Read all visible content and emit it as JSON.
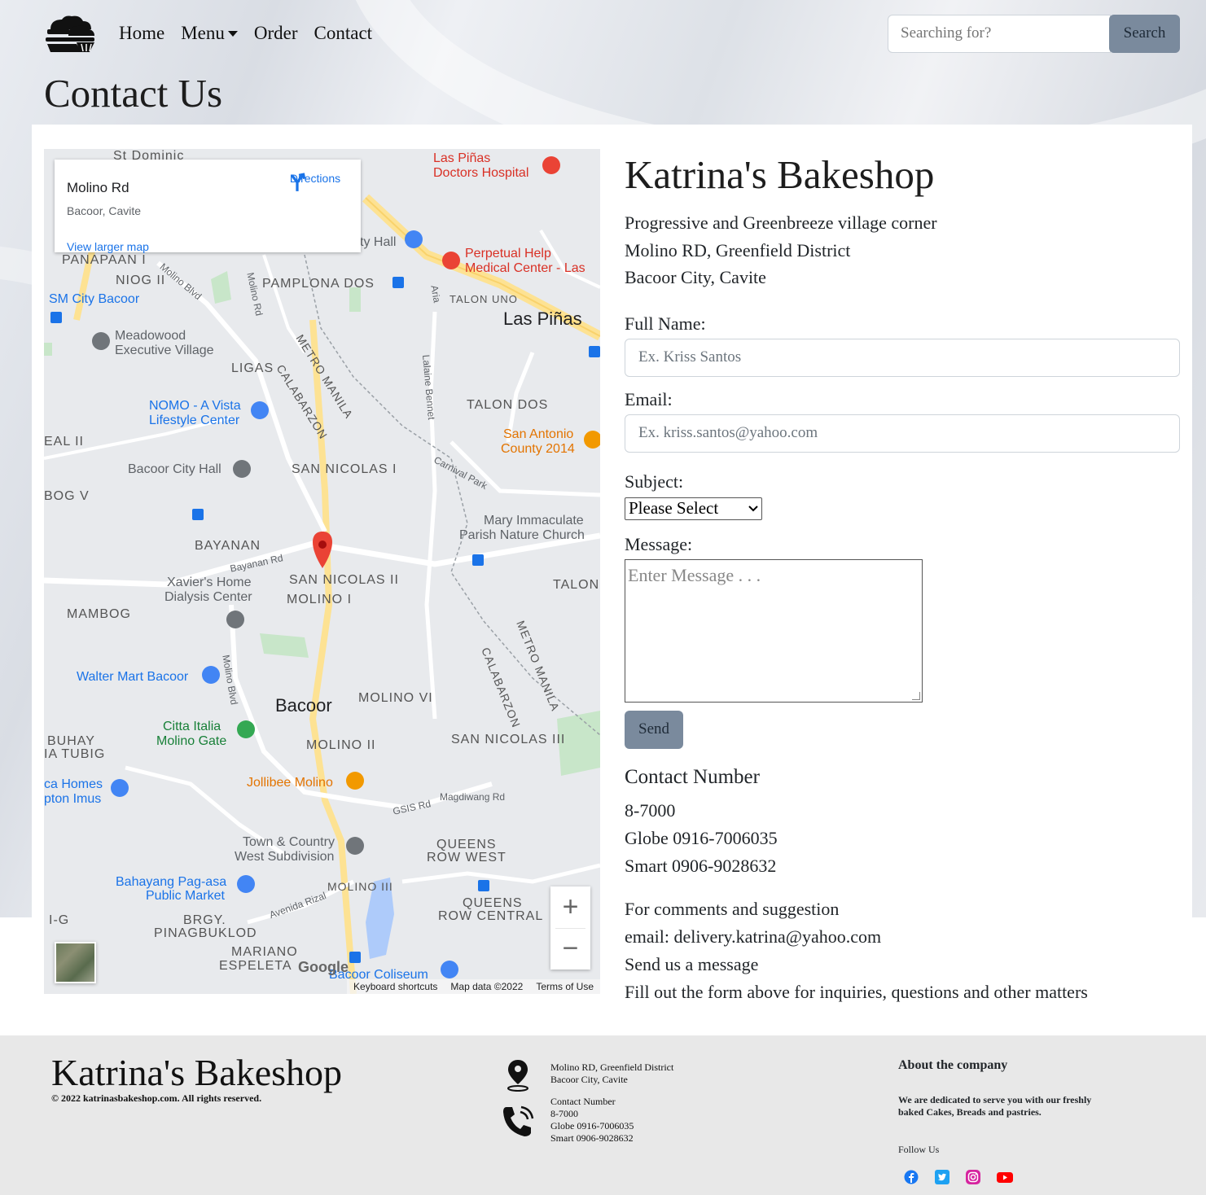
{
  "nav": {
    "items": [
      "Home",
      "Menu",
      "Order",
      "Contact"
    ],
    "search_placeholder": "Searching for?",
    "search_button": "Search"
  },
  "page_title": "Contact Us",
  "map": {
    "info_title": "Molino Rd",
    "info_subtitle": "Bacoor, Cavite",
    "directions": "Directions",
    "view_larger": "View larger map",
    "footer": [
      "Keyboard shortcuts",
      "Map data ©2022",
      "Terms of Use"
    ],
    "google": "Google",
    "zoom_in": "+",
    "zoom_out": "−",
    "labels": {
      "st_dominic": "St Dominic",
      "panapaan": "PANAPAAN I",
      "niog": "NIOG II",
      "pamplona": "PAMPLONA DOS",
      "talon_uno": "TALON UNO",
      "las_pinas": "Las Piñas",
      "sm_city": "SM City Bacoor",
      "meadowood1": "Meadowood",
      "meadowood2": "Executive Village",
      "ligas": "LIGAS",
      "metro_manila": "METRO MANILA",
      "calabarzon": "CALABARZON",
      "talon_dos": "TALON DOS",
      "nomo1": "NOMO - A Vista",
      "nomo2": "Lifestyle Center",
      "san_antonio1": "San Antonio",
      "san_antonio2": "County 2014",
      "real": "EAL II",
      "bacoor_hall": "Bacoor City Hall",
      "san_nicolas1": "SAN NICOLAS I",
      "bog": "BOG V",
      "mary1": "Mary Immaculate",
      "mary2": "Parish Nature Church",
      "bayanan": "BAYANAN",
      "bayanan_rd": "Bayanan Rd",
      "san_nicolas2": "SAN NICOLAS II",
      "molino1": "MOLINO I",
      "talon": "TALON",
      "xavier1": "Xavier's Home",
      "xavier2": "Dialysis Center",
      "mambog": "MAMBOG",
      "walter": "Walter Mart Bacoor",
      "bacoor": "Bacoor",
      "molino6": "MOLINO VI",
      "citta1": "Citta Italia",
      "citta2": "Molino Gate",
      "buhay": "BUHAY",
      "tubig": "IA TUBIG",
      "molino2": "MOLINO II",
      "san_nicolas3": "SAN NICOLAS III",
      "jollibee": "Jollibee Molino",
      "ca_homes": "ca Homes",
      "pton": "pton Imus",
      "magdiwang": "Magdiwang Rd",
      "gsis": "GSIS Rd",
      "town1": "Town & Country",
      "town2": "West Subdivision",
      "queens1": "QUEENS",
      "queens2": "ROW WEST",
      "bahayang1": "Bahayang Pag-asa",
      "bahayang2": "Public Market",
      "molino3": "MOLINO III",
      "avenida": "Avenida Rizal",
      "queens3": "QUEENS",
      "queens4": "ROW CENTRAL",
      "ig": "I-G",
      "brgy": "BRGY.",
      "pinagbuklod": "PINAGBUKLOD",
      "mariano": "MARIANO",
      "espeleta": "ESPELETA",
      "coliseum": "Bacoor Coliseum",
      "lp_doctors1": "Las Piñas",
      "lp_doctors2": "Doctors Hospital",
      "perpetual1": "Perpetual Help",
      "perpetual2": "Medical Center -  Las",
      "ty_hall": "ty Hall",
      "molino_rd_v": "Molino Rd",
      "molino_blvd": "Molino Blvd",
      "molino_blvd2": "Molino Blvd",
      "aria": "Aria",
      "lalaine": "Lalaine Bennet",
      "carnival": "Carnival Park",
      "metro_manila2": "METRO MANILA",
      "calabarzon2": "CALABARZON"
    }
  },
  "shop": {
    "title": "Katrina's Bakeshop",
    "address": [
      "Progressive and Greenbreeze village corner",
      "Molino RD, Greenfield District",
      "Bacoor City, Cavite"
    ]
  },
  "form": {
    "full_name_label": "Full Name:",
    "full_name_placeholder": "Ex. Kriss Santos",
    "email_label": "Email:",
    "email_placeholder": "Ex. kriss.santos@yahoo.com",
    "subject_label": "Subject:",
    "subject_selected": "Please Select",
    "message_label": "Message:",
    "message_placeholder": "Enter Message . . .",
    "send": "Send"
  },
  "contact": {
    "heading": "Contact Number",
    "numbers": [
      "8-7000",
      "Globe 0916-7006035",
      "Smart 0906-9028632"
    ],
    "comments": "For comments and suggestion",
    "email": "email: delivery.katrina@yahoo.com",
    "send_msg": "Send us a message",
    "fill_out": "Fill out the form above for inquiries, questions and other matters"
  },
  "footer": {
    "title": "Katrina's Bakeshop",
    "copyright": "2022 katrinasbakeshop.com. All rights reserved.",
    "address": [
      "Molino RD, Greenfield District",
      "Bacoor City, Cavite"
    ],
    "contact": [
      "Contact Number",
      "8-7000",
      "Globe 0916-7006035",
      "Smart 0906-9028632"
    ],
    "about_heading": "About the company",
    "about_text": "We are dedicated to serve you with our freshly baked Cakes, Breads and pastries.",
    "follow": "Follow Us",
    "social_colors": {
      "facebook": "#1877f2",
      "twitter": "#1da1f2",
      "instagram": "#d6249f",
      "youtube": "#ff0000"
    }
  }
}
